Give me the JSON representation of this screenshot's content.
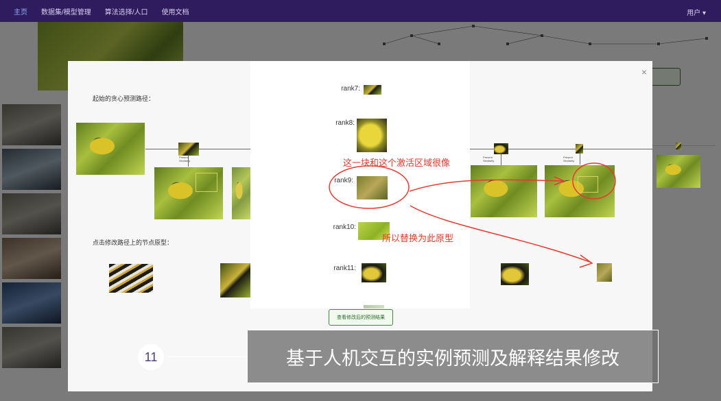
{
  "nav": {
    "items": [
      "主页",
      "数据集/模型管理",
      "算法选择/人口",
      "使用文档"
    ],
    "user": "用户 ▾"
  },
  "dialog": {
    "close_label": "×",
    "path_title": "起始的贪心预测路径：",
    "edit_title": "点击修改路径上的节点原型：",
    "view_button": "查看修改后的预测结果"
  },
  "rank_panel": {
    "ranks": [
      {
        "label": "rank7:",
        "img": "branch-crop-icon"
      },
      {
        "label": "rank8:",
        "img": "yellow-breast-crop-icon"
      },
      {
        "label": "rank9:",
        "img": "branch-patch-crop-icon"
      },
      {
        "label": "rank10:",
        "img": "leaf-crop-icon"
      },
      {
        "label": "rank11:",
        "img": "head-crop-icon"
      }
    ]
  },
  "annotations": {
    "note1": "这一块和这个激活区域很像",
    "note2": "所以替换为此原型"
  },
  "caption": {
    "number": "11",
    "text": "基于人机交互的实例预测及解释结果修改"
  }
}
